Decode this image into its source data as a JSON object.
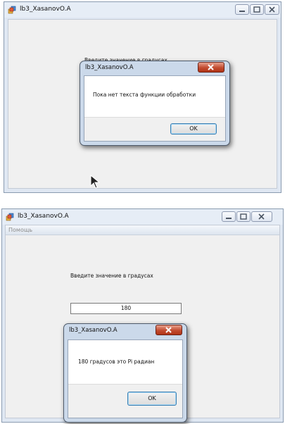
{
  "screen1": {
    "window_title": "lb3_XasanovO.A",
    "prompt_label": "Введите значение в градусах",
    "dialog": {
      "title": "lb3_XasanovO.A",
      "message": "Пока нет текста функции обработки",
      "ok_label": "OK"
    }
  },
  "screen2": {
    "window_title": "lb3_XasanovO.A",
    "menu_help": "Помощь",
    "prompt_label": "Введите значение в градусах",
    "degrees_value": "180",
    "dialog": {
      "title": "lb3_XasanovO.A",
      "message": "180 градусов это Pi радиан",
      "ok_label": "OK"
    }
  }
}
